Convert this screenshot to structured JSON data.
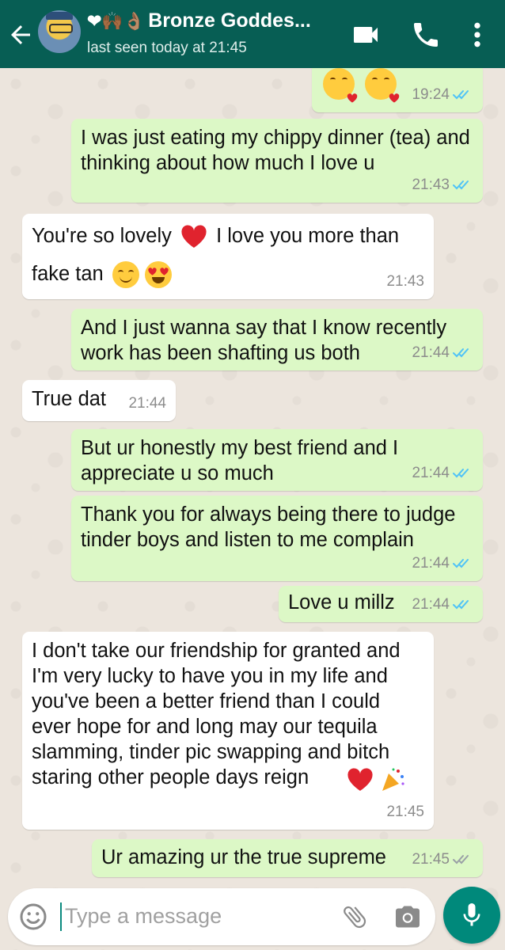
{
  "header": {
    "title": "Bronze Goddes...",
    "title_emojis": "❤🙌🏾👌🏽",
    "subtitle": "last seen today at 21:45"
  },
  "messages": [
    {
      "dir": "out",
      "text": "",
      "time": "19:24",
      "status": "read",
      "emojis": [
        "kissing-heart-face",
        "kissing-heart-face"
      ]
    },
    {
      "dir": "out",
      "text": "I was just eating my chippy dinner (tea) and thinking about how much I love u",
      "time": "21:43",
      "status": "read"
    },
    {
      "dir": "in",
      "text_line1": "You're so lovely",
      "text_line1b": "I love you more than",
      "text_line2": "fake tan",
      "time": "21:43"
    },
    {
      "dir": "out",
      "text": "And I just wanna say that I know recently work has been shafting us both",
      "time": "21:44",
      "status": "read"
    },
    {
      "dir": "in",
      "text": "True dat",
      "time": "21:44"
    },
    {
      "dir": "out",
      "text": "But ur honestly my best friend and I appreciate u so much",
      "time": "21:44",
      "status": "read"
    },
    {
      "dir": "out",
      "text": "Thank you for always being there to judge tinder boys and listen to me complain",
      "time": "21:44",
      "status": "read"
    },
    {
      "dir": "out",
      "text": "Love u millz",
      "time": "21:44",
      "status": "read"
    },
    {
      "dir": "in",
      "text": "I don't take our friendship for granted and I'm very lucky to have you in my life and you've been a better friend than I could ever hope for and long may our tequila slamming, tinder pic swapping and bitch staring other people days reign",
      "time": "21:45"
    },
    {
      "dir": "out",
      "text": "Ur amazing ur the true supreme",
      "time": "21:45",
      "status": "delivered"
    }
  ],
  "input": {
    "placeholder": "Type a message"
  },
  "colors": {
    "header": "#075e54",
    "outgoing_bubble": "#dcf8c6",
    "incoming_bubble": "#ffffff",
    "read_tick": "#4fc3f7",
    "mic_button": "#00897b"
  }
}
